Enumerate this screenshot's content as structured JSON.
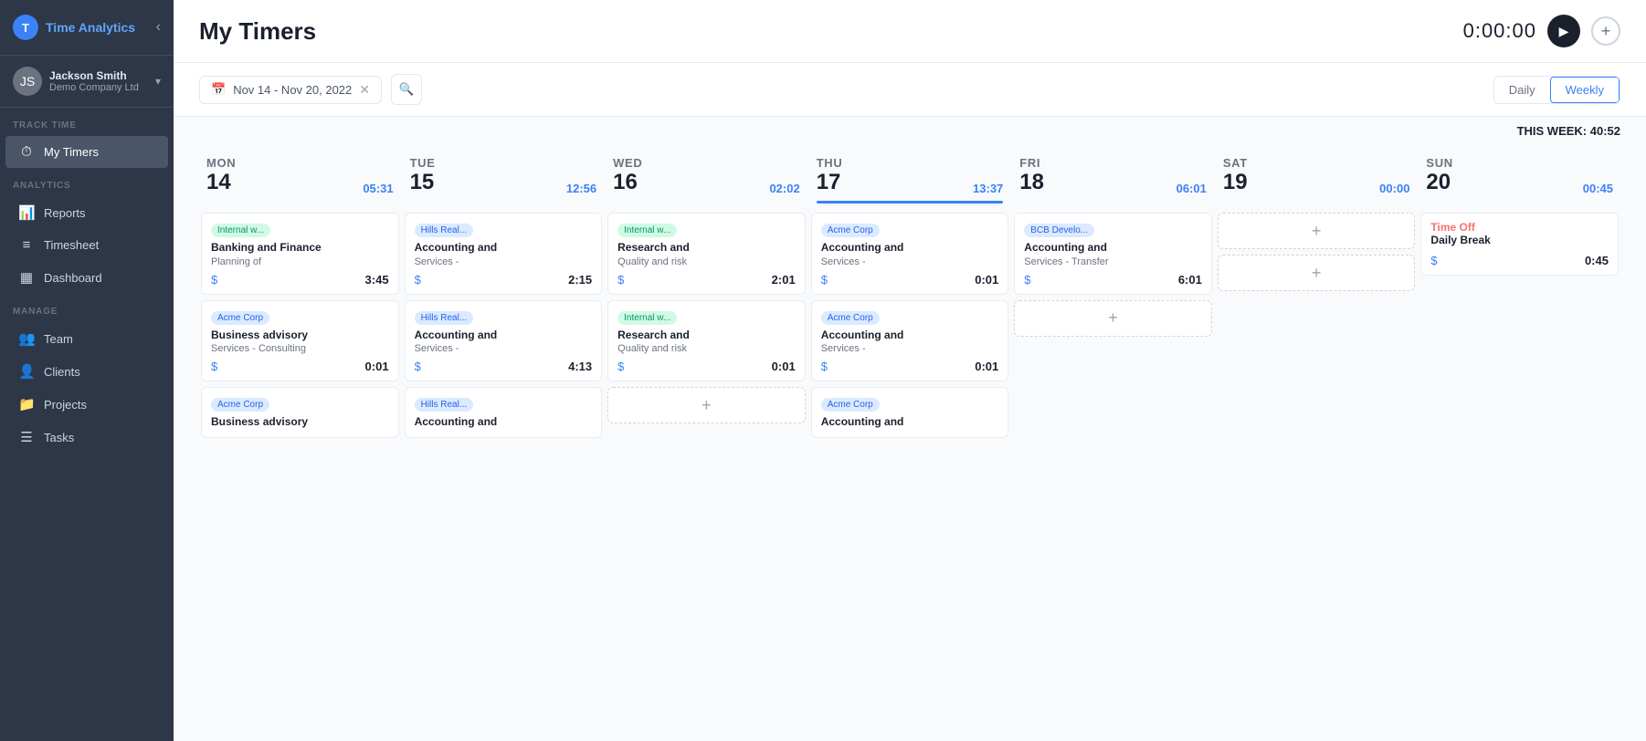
{
  "app": {
    "name": "Time Analytics",
    "logo_letter": "T"
  },
  "user": {
    "name": "Jackson Smith",
    "company": "Demo Company Ltd",
    "avatar": "JS"
  },
  "sidebar": {
    "section_track": "TRACK TIME",
    "section_analytics": "ANALYTICS",
    "section_manage": "MANAGE",
    "items_track": [
      {
        "label": "My Timers",
        "icon": "⏱",
        "active": true,
        "key": "my-timers"
      }
    ],
    "items_analytics": [
      {
        "label": "Reports",
        "icon": "📊",
        "active": false,
        "key": "reports"
      },
      {
        "label": "Timesheet",
        "icon": "≡",
        "active": false,
        "key": "timesheet"
      },
      {
        "label": "Dashboard",
        "icon": "▦",
        "active": false,
        "key": "dashboard"
      }
    ],
    "items_manage": [
      {
        "label": "Team",
        "icon": "👥",
        "active": false,
        "key": "team"
      },
      {
        "label": "Clients",
        "icon": "👤",
        "active": false,
        "key": "clients"
      },
      {
        "label": "Projects",
        "icon": "📁",
        "active": false,
        "key": "projects"
      },
      {
        "label": "Tasks",
        "icon": "☰",
        "active": false,
        "key": "tasks"
      }
    ]
  },
  "header": {
    "title": "My Timers",
    "timer": "0:00:00",
    "play_label": "▶",
    "add_label": "+"
  },
  "toolbar": {
    "date_range": "Nov 14 - Nov 20, 2022",
    "search_placeholder": "Search",
    "view_daily": "Daily",
    "view_weekly": "Weekly"
  },
  "week_summary": "THIS WEEK: 40:52",
  "calendar": {
    "days": [
      {
        "name": "MON",
        "num": "14",
        "total": "05:31",
        "is_today": false,
        "cards": [
          {
            "client": "Internal w...",
            "badge_type": "green",
            "title": "Banking and Finance",
            "desc": "Planning of",
            "dollar": "$",
            "time": "3:45"
          },
          {
            "client": "Acme Corp",
            "badge_type": "blue",
            "title": "Business advisory",
            "desc": "Services - Consulting",
            "dollar": "$",
            "time": "0:01"
          },
          {
            "client": "Acme Corp",
            "badge_type": "blue",
            "title": "Business advisory",
            "desc": "",
            "dollar": "",
            "time": ""
          }
        ]
      },
      {
        "name": "TUE",
        "num": "15",
        "total": "12:56",
        "is_today": false,
        "cards": [
          {
            "client": "Hills Real...",
            "badge_type": "blue",
            "title": "Accounting and",
            "desc": "Services -",
            "dollar": "$",
            "time": "2:15"
          },
          {
            "client": "Hills Real...",
            "badge_type": "blue",
            "title": "Accounting and",
            "desc": "Services -",
            "dollar": "$",
            "time": "4:13"
          },
          {
            "client": "Hills Real...",
            "badge_type": "blue",
            "title": "Accounting and",
            "desc": "",
            "dollar": "",
            "time": ""
          }
        ]
      },
      {
        "name": "WED",
        "num": "16",
        "total": "02:02",
        "is_today": false,
        "has_add": true,
        "cards": [
          {
            "client": "Internal w...",
            "badge_type": "green",
            "title": "Research and",
            "desc": "Quality and risk",
            "dollar": "$",
            "time": "2:01"
          },
          {
            "client": "Internal w...",
            "badge_type": "green",
            "title": "Research and",
            "desc": "Quality and risk",
            "dollar": "$",
            "time": "0:01"
          }
        ]
      },
      {
        "name": "THU",
        "num": "17",
        "total": "13:37",
        "is_today": true,
        "cards": [
          {
            "client": "Acme Corp",
            "badge_type": "blue",
            "title": "Accounting and",
            "desc": "Services -",
            "dollar": "$",
            "time": "0:01"
          },
          {
            "client": "Acme Corp",
            "badge_type": "blue",
            "title": "Accounting and",
            "desc": "Services -",
            "dollar": "$",
            "time": "0:01"
          },
          {
            "client": "Acme Corp",
            "badge_type": "blue",
            "title": "Accounting and",
            "desc": "",
            "dollar": "",
            "time": ""
          }
        ]
      },
      {
        "name": "FRI",
        "num": "18",
        "total": "06:01",
        "is_today": false,
        "has_add": true,
        "cards": [
          {
            "client": "BCB Develo...",
            "badge_type": "blue",
            "title": "Accounting and",
            "desc": "Services - Transfer",
            "dollar": "$",
            "time": "6:01"
          }
        ]
      },
      {
        "name": "SAT",
        "num": "19",
        "total": "00:00",
        "is_today": false,
        "has_add_top": true,
        "has_add_bottom": true,
        "cards": []
      },
      {
        "name": "SUN",
        "num": "20",
        "total": "00:45",
        "is_today": false,
        "cards": [
          {
            "client": "Time Off",
            "badge_type": "pink",
            "title": "Daily Break",
            "desc": "",
            "dollar": "$",
            "time": "0:45"
          }
        ]
      }
    ]
  }
}
